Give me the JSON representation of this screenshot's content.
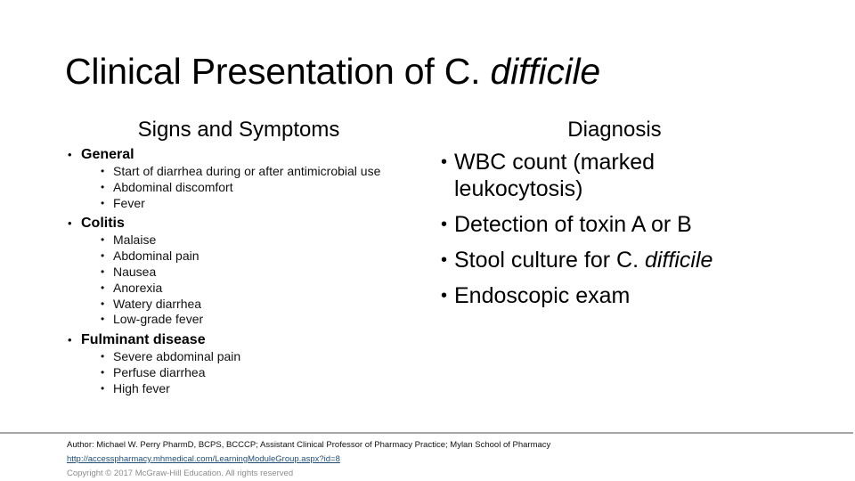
{
  "title": {
    "prefix": "Clinical Presentation of C. ",
    "italic": "difficile"
  },
  "left": {
    "heading": "Signs and Symptoms",
    "groups": [
      {
        "label": "General",
        "items": [
          "Start of diarrhea during or after antimicrobial use",
          "Abdominal discomfort",
          "Fever"
        ]
      },
      {
        "label": "Colitis",
        "items": [
          "Malaise",
          "Abdominal pain",
          "Nausea",
          "Anorexia",
          "Watery diarrhea",
          "Low-grade fever"
        ]
      },
      {
        "label": "Fulminant disease",
        "items": [
          "Severe abdominal pain",
          "Perfuse diarrhea",
          "High fever"
        ]
      }
    ]
  },
  "right": {
    "heading": "Diagnosis",
    "items": [
      {
        "text": "WBC count (marked leukocytosis)",
        "italic": ""
      },
      {
        "text": "Detection of toxin A or B",
        "italic": ""
      },
      {
        "text": "Stool culture for C. ",
        "italic": "difficile"
      },
      {
        "text": "Endoscopic exam",
        "italic": ""
      }
    ]
  },
  "bullet_glyph": "•",
  "footer": {
    "author": "Author: Michael W. Perry PharmD, BCPS, BCCCP; Assistant Clinical Professor of Pharmacy Practice; Mylan School of Pharmacy",
    "link": "http://accesspharmacy.mhmedical.com/LearningModuleGroup.aspx?id=8",
    "copyright": "Copyright © 2017 McGraw-Hill Education. All rights reserved"
  }
}
